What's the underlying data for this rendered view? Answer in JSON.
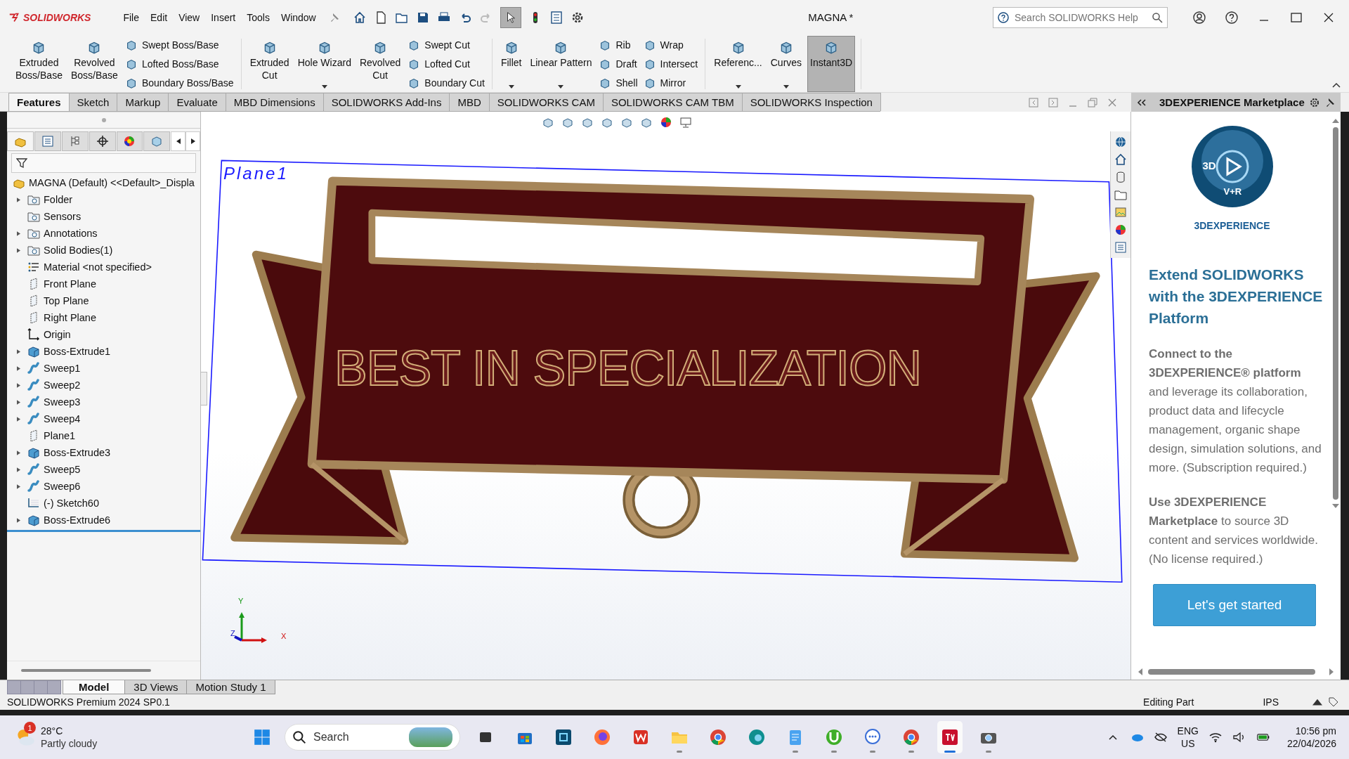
{
  "titlebar": {
    "logo": "SOLIDWORKS",
    "menu": [
      "File",
      "Edit",
      "View",
      "Insert",
      "Tools",
      "Window"
    ],
    "title": "MAGNA *",
    "search_placeholder": "Search SOLIDWORKS Help"
  },
  "ribbon": [
    {
      "columns": [
        {
          "kind": "large",
          "lines": [
            "Extruded",
            "Boss/Base"
          ],
          "dropdown": false,
          "on": false
        },
        {
          "kind": "large",
          "lines": [
            "Revolved",
            "Boss/Base"
          ],
          "dropdown": false,
          "on": false
        },
        {
          "kind": "stack",
          "items": [
            "Swept Boss/Base",
            "Lofted Boss/Base",
            "Boundary Boss/Base"
          ]
        }
      ]
    },
    {
      "columns": [
        {
          "kind": "large",
          "lines": [
            "Extruded",
            "Cut"
          ],
          "dropdown": false,
          "on": false
        },
        {
          "kind": "large",
          "lines": [
            "Hole Wizard"
          ],
          "dropdown": true,
          "on": false
        },
        {
          "kind": "large",
          "lines": [
            "Revolved",
            "Cut"
          ],
          "dropdown": false,
          "on": false
        },
        {
          "kind": "stack",
          "items": [
            "Swept Cut",
            "Lofted Cut",
            "Boundary Cut"
          ]
        }
      ]
    },
    {
      "columns": [
        {
          "kind": "large",
          "lines": [
            "Fillet"
          ],
          "dropdown": true,
          "on": false
        },
        {
          "kind": "large",
          "lines": [
            "Linear Pattern"
          ],
          "dropdown": true,
          "on": false
        },
        {
          "kind": "stack",
          "items": [
            "Rib",
            "Draft",
            "Shell"
          ]
        },
        {
          "kind": "stack",
          "items": [
            "Wrap",
            "Intersect",
            "Mirror"
          ]
        }
      ]
    },
    {
      "columns": [
        {
          "kind": "large",
          "lines": [
            "Referenc..."
          ],
          "dropdown": true,
          "on": false
        },
        {
          "kind": "large",
          "lines": [
            "Curves"
          ],
          "dropdown": true,
          "on": false
        },
        {
          "kind": "large",
          "lines": [
            "Instant3D"
          ],
          "dropdown": false,
          "on": true
        }
      ]
    }
  ],
  "tabs": [
    {
      "label": "Features",
      "selected": true
    },
    {
      "label": "Sketch",
      "selected": false
    },
    {
      "label": "Markup",
      "selected": false
    },
    {
      "label": "Evaluate",
      "selected": false
    },
    {
      "label": "MBD Dimensions",
      "selected": false
    },
    {
      "label": "SOLIDWORKS Add-Ins",
      "selected": false
    },
    {
      "label": "MBD",
      "selected": false
    },
    {
      "label": "SOLIDWORKS CAM",
      "selected": false
    },
    {
      "label": "SOLIDWORKS CAM TBM",
      "selected": false
    },
    {
      "label": "SOLIDWORKS Inspection",
      "selected": false
    }
  ],
  "tree": {
    "root": "MAGNA (Default) <<Default>_Displa",
    "items": [
      {
        "label": "Folder",
        "kind": "folder",
        "expanded": false
      },
      {
        "label": "Sensors",
        "kind": "folder"
      },
      {
        "label": "Annotations",
        "kind": "folder",
        "expanded": false
      },
      {
        "label": "Solid Bodies(1)",
        "kind": "folder",
        "expanded": false
      },
      {
        "label": "Material <not specified>",
        "kind": "material"
      },
      {
        "label": "Front Plane",
        "kind": "plane"
      },
      {
        "label": "Top Plane",
        "kind": "plane"
      },
      {
        "label": "Right Plane",
        "kind": "plane"
      },
      {
        "label": "Origin",
        "kind": "origin"
      },
      {
        "label": "Boss-Extrude1",
        "kind": "extrude",
        "expanded": false
      },
      {
        "label": "Sweep1",
        "kind": "sweep",
        "expanded": false
      },
      {
        "label": "Sweep2",
        "kind": "sweep",
        "expanded": false
      },
      {
        "label": "Sweep3",
        "kind": "sweep",
        "expanded": false
      },
      {
        "label": "Sweep4",
        "kind": "sweep",
        "expanded": false
      },
      {
        "label": "Plane1",
        "kind": "plane"
      },
      {
        "label": "Boss-Extrude3",
        "kind": "extrude",
        "expanded": false
      },
      {
        "label": "Sweep5",
        "kind": "sweep",
        "expanded": false
      },
      {
        "label": "Sweep6",
        "kind": "sweep",
        "expanded": false
      },
      {
        "label": "(-) Sketch60",
        "kind": "sketch"
      },
      {
        "label": "Boss-Extrude6",
        "kind": "extrude",
        "expanded": false
      }
    ]
  },
  "viewport": {
    "plane_label": "Plane1",
    "engraving": "BEST IN SPECIALIZATION",
    "axes": [
      "X",
      "Y",
      "Z"
    ]
  },
  "bottom_tabs": [
    {
      "label": "Model",
      "selected": true
    },
    {
      "label": "3D Views",
      "selected": false
    },
    {
      "label": "Motion Study 1",
      "selected": false
    }
  ],
  "marketplace": {
    "title": "3DEXPERIENCE Marketplace",
    "logo_marks": [
      "3D",
      "V+R"
    ],
    "logo_word": "3DEXPERIENCE",
    "heading": "Extend SOLIDWORKS with the 3DEXPERIENCE Platform",
    "paragraphs": [
      "**Connect to the 3DEXPERIENCE® platform** and leverage its collaboration, product data and lifecycle management, organic shape design, simulation solutions, and more. (Subscription required.)",
      "**Use 3DEXPERIENCE Marketplace** to source 3D content and services worldwide. (No license required.)"
    ],
    "button": "Let's get started"
  },
  "status_bar": {
    "version": "SOLIDWORKS Premium 2024 SP0.1",
    "mode": "Editing Part",
    "units": "IPS"
  },
  "taskbar": {
    "weather_badge": "1",
    "temperature": "28°C",
    "weather": "Partly cloudy",
    "search": "Search",
    "apps": [
      {
        "kind": "taskview",
        "running": false,
        "selected": false
      },
      {
        "kind": "store",
        "running": false,
        "selected": false
      },
      {
        "kind": "cube",
        "running": false,
        "selected": false
      },
      {
        "kind": "firefox",
        "running": false,
        "selected": false
      },
      {
        "kind": "office",
        "running": false,
        "selected": false
      },
      {
        "kind": "files",
        "running": true,
        "selected": false
      },
      {
        "kind": "chrome",
        "running": false,
        "selected": false
      },
      {
        "kind": "edge",
        "running": false,
        "selected": false
      },
      {
        "kind": "notepad",
        "running": true,
        "selected": false
      },
      {
        "kind": "torrent",
        "running": true,
        "selected": false
      },
      {
        "kind": "chat",
        "running": true,
        "selected": false
      },
      {
        "kind": "chrome",
        "running": true,
        "selected": false
      },
      {
        "kind": "solidworks",
        "running": true,
        "selected": true
      },
      {
        "kind": "camera",
        "running": true,
        "selected": false
      }
    ],
    "language": "ENG",
    "region": "US",
    "time": "10:56 pm",
    "date": "22/04/2026"
  }
}
